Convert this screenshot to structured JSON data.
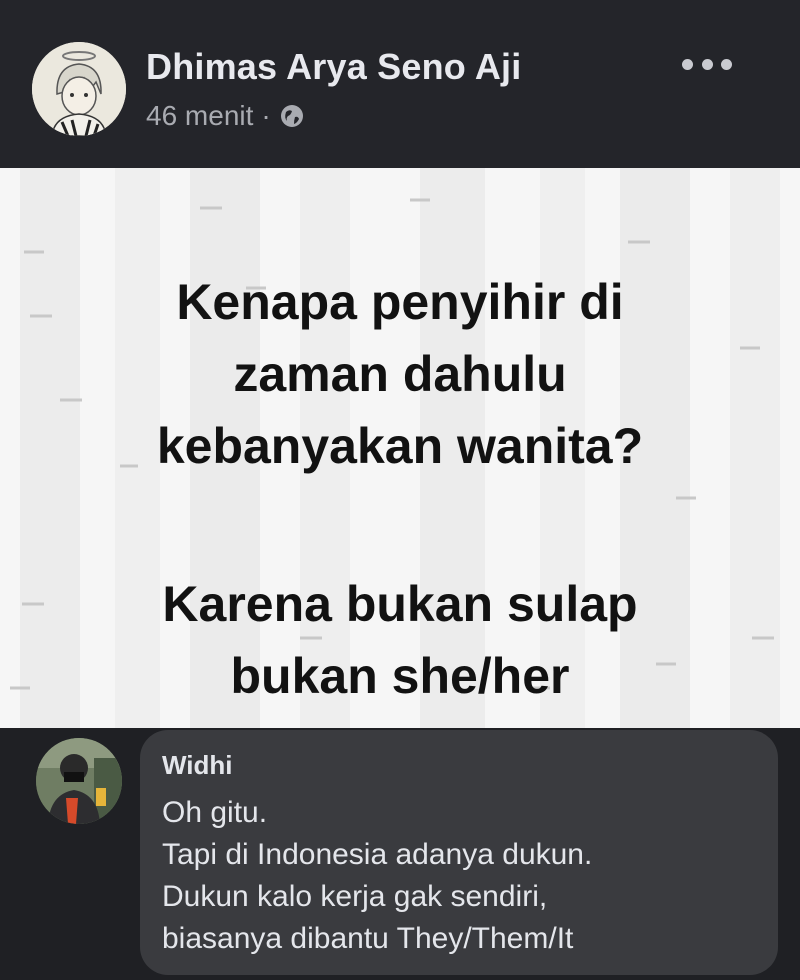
{
  "post": {
    "author": "Dhimas Arya Seno Aji",
    "time": "46 menit",
    "separator": "·",
    "privacy_icon": "globe-icon",
    "more_icon": "more-options-icon"
  },
  "image": {
    "question_lines": [
      "Kenapa penyihir di",
      "zaman dahulu",
      "kebanyakan wanita?"
    ],
    "answer_lines": [
      "Karena bukan sulap",
      "bukan she/her"
    ]
  },
  "comment": {
    "name": "Widhi",
    "lines": [
      "Oh gitu.",
      "Tapi di Indonesia adanya dukun.",
      "Dukun kalo kerja gak sendiri,",
      "biasanya dibantu They/Them/It"
    ]
  },
  "colors": {
    "header_bg": "#24252a",
    "bubble_bg": "#3a3b3f",
    "image_bg": "#f6f6f6"
  }
}
